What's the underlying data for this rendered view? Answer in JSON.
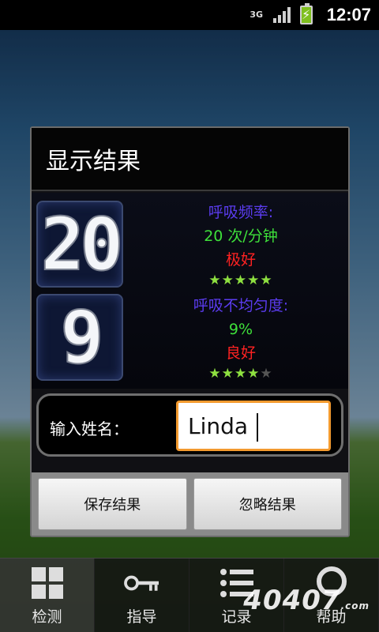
{
  "status_bar": {
    "network": "3G",
    "time": "12:07"
  },
  "dialog": {
    "title": "显示结果",
    "breathing_rate": {
      "display_value": "20",
      "label": "呼吸频率:",
      "value": "20 次/分钟",
      "rating": "极好",
      "stars": 5,
      "max_stars": 5
    },
    "irregularity": {
      "display_value": "9",
      "label": "呼吸不均匀度:",
      "value": "9%",
      "rating": "良好",
      "stars": 4,
      "max_stars": 5
    },
    "name_label": "输入姓名：",
    "name_value": "Linda",
    "save_label": "保存结果",
    "ignore_label": "忽略结果"
  },
  "tabs": [
    {
      "label": "检测",
      "icon": "grid-icon",
      "active": true
    },
    {
      "label": "指导",
      "icon": "key-icon",
      "active": false
    },
    {
      "label": "记录",
      "icon": "list-icon",
      "active": false
    },
    {
      "label": "帮助",
      "icon": "help-icon",
      "active": false
    }
  ],
  "watermark": {
    "text": "40407",
    "suffix": ".com"
  },
  "colors": {
    "label": "#5b3cf0",
    "value": "#3ee03a",
    "rating": "#ff2222",
    "input_border": "#f39a2f"
  }
}
